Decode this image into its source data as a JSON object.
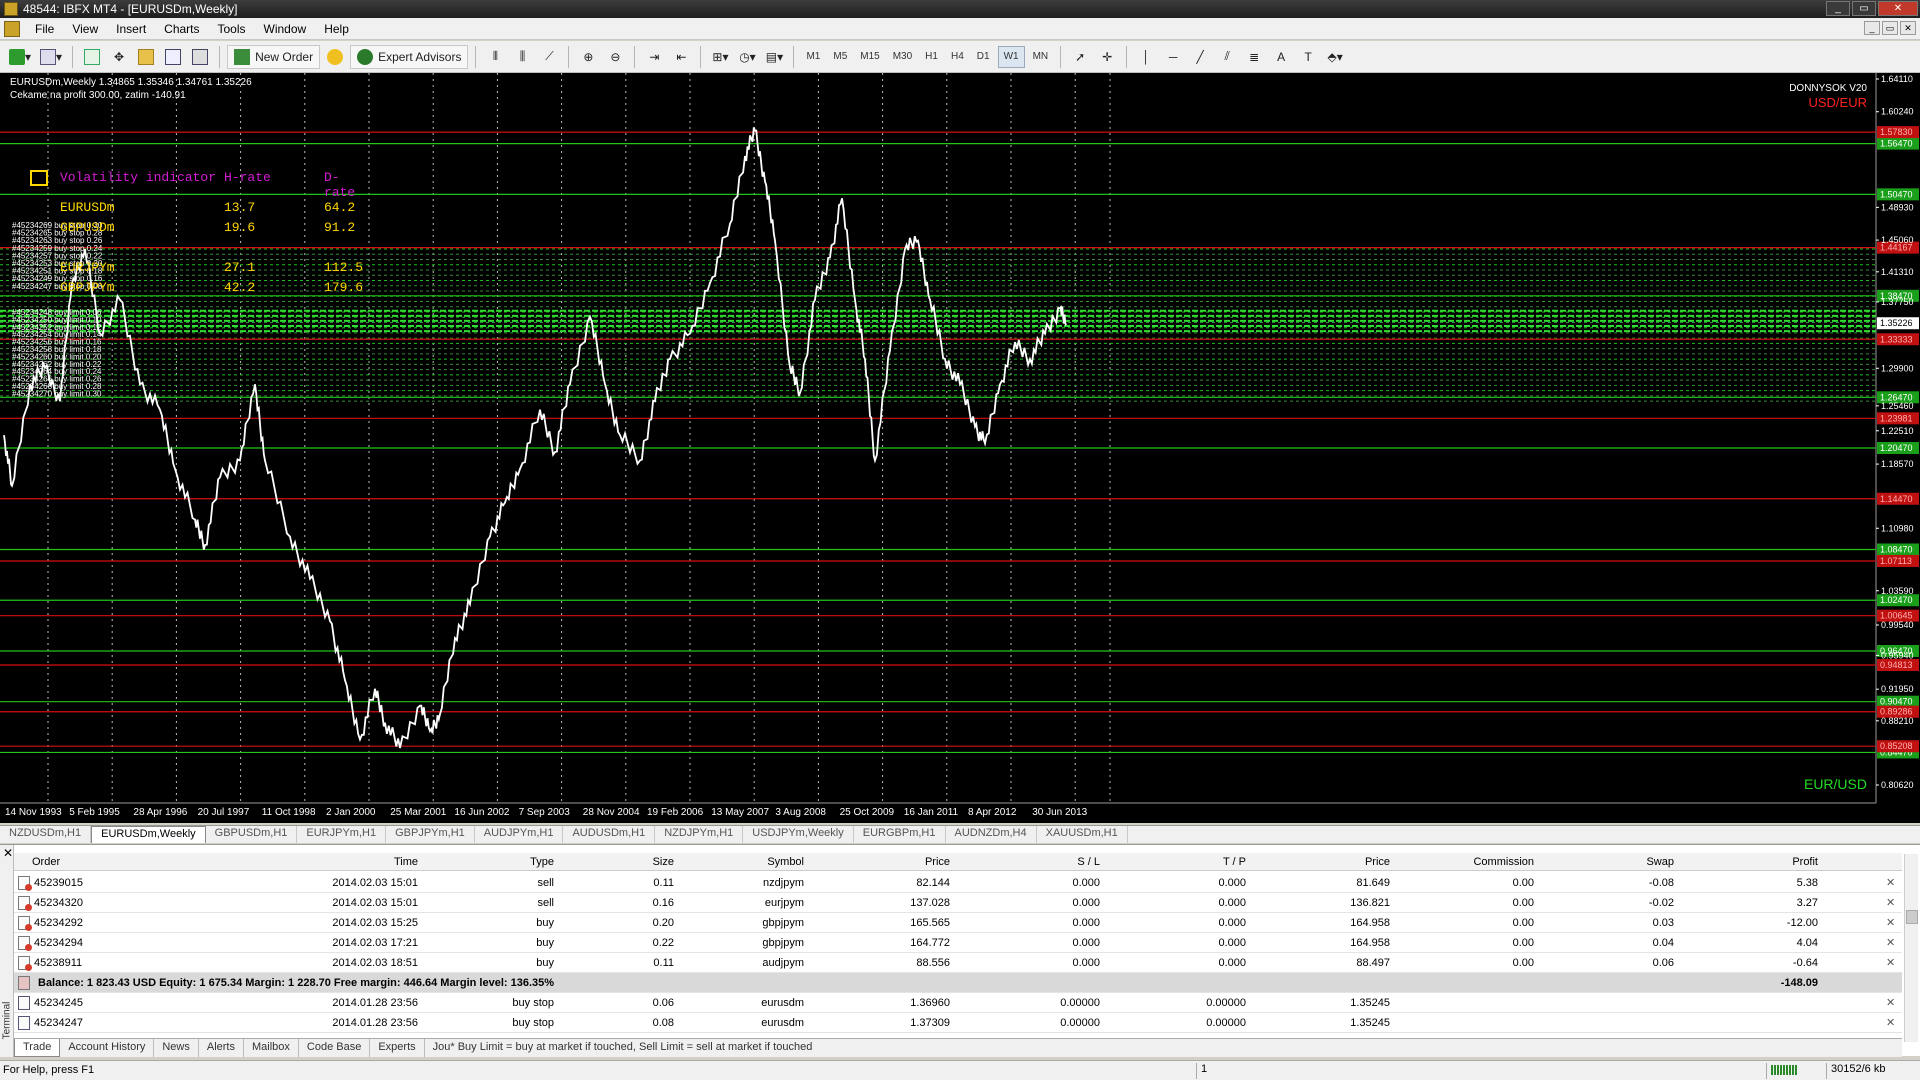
{
  "window": {
    "title": "48544: IBFX MT4 - [EURUSDm,Weekly]"
  },
  "menu": [
    "File",
    "View",
    "Insert",
    "Charts",
    "Tools",
    "Window",
    "Help"
  ],
  "toolbar": {
    "new_order": "New Order",
    "expert_advisors": "Expert Advisors",
    "timeframes": [
      "M1",
      "M5",
      "M15",
      "M30",
      "H1",
      "H4",
      "D1",
      "W1",
      "MN"
    ],
    "active_timeframe": "W1"
  },
  "chart": {
    "header_line1": "EURUSDm,Weekly  1.34865 1.35346 1.34761 1.35226",
    "header_line2": "Cekame na profit 300.00, zatim -140.91",
    "symbol_top": "DONNYSOK V20",
    "symbol_red": "USD/EUR",
    "symbol_green": "EUR/USD",
    "current_price": "1.35226",
    "x_labels": [
      "14 Nov 1993",
      "5 Feb 1995",
      "28 Apr 1996",
      "20 Jul 1997",
      "11 Oct 1998",
      "2 Jan 2000",
      "25 Mar 2001",
      "16 Jun 2002",
      "7 Sep 2003",
      "28 Nov 2004",
      "19 Feb 2006",
      "13 May 2007",
      "3 Aug 2008",
      "25 Oct 2009",
      "16 Jan 2011",
      "8 Apr 2012",
      "30 Jun 2013"
    ],
    "price_labels": [
      "1.64110",
      "1.60240",
      "1.48930",
      "1.45060",
      "1.41310",
      "1.37750",
      "1.29900",
      "1.25460",
      "1.22510",
      "1.18570",
      "1.10980",
      "1.03590",
      "0.99540",
      "0.95940",
      "0.91950",
      "0.88210",
      "0.80620"
    ],
    "green_lines": [
      "1.56470",
      "1.50470",
      "1.38470",
      "1.26470",
      "1.20470",
      "1.08470",
      "1.02470",
      "0.96470",
      "0.90470",
      "0.84470"
    ],
    "red_lines": [
      "1.57830",
      "1.44167",
      "1.33333",
      "1.23981",
      "1.14470",
      "1.07113",
      "1.00645",
      "0.94813",
      "0.89286",
      "0.85208"
    ],
    "order_lines_top": [
      "#45234269 buy stop 0.30",
      "#45234265 buy stop 0.28",
      "#45234263 buy stop 0.26",
      "#45234259 buy stop 0.24",
      "#45234257 buy stop 0.22",
      "#45234253 buy stop 0.20",
      "#45234251 buy stop 0.18",
      "#45234249 buy stop 0.16",
      "#45234247 buy stop 0.08"
    ],
    "order_lines_bottom": [
      "#45234248 buy limit 0.06",
      "#45234250 buy limit 0.10",
      "#45234252 buy limit 0.12",
      "#45234254 buy limit 0.14",
      "#45234256 buy limit 0.16",
      "#45234258 buy limit 0.18",
      "#45234260 buy limit 0.20",
      "#45234262 buy limit 0.22",
      "#45234264 buy limit 0.24",
      "#45234266 buy limit 0.26",
      "#45234268 buy limit 0.28",
      "#45234270 buy limit 0.30"
    ]
  },
  "indicator": {
    "title": "Volatility indicator",
    "col_h": "H-rate",
    "col_d": "D-rate",
    "rows": [
      {
        "symbol": "EURUSDm",
        "h": "13.7",
        "d": "64.2"
      },
      {
        "symbol": "GBPUSDm",
        "h": "19.6",
        "d": "91.2"
      },
      {
        "symbol": "EURJPYm",
        "h": "27.1",
        "d": "112.5"
      },
      {
        "symbol": "GBPJPYm",
        "h": "42.2",
        "d": "179.6"
      }
    ]
  },
  "chart_tabs": [
    "NZDUSDm,H1",
    "EURUSDm,Weekly",
    "GBPUSDm,H1",
    "EURJPYm,H1",
    "GBPJPYm,H1",
    "AUDJPYm,H1",
    "AUDUSDm,H1",
    "NZDJPYm,H1",
    "USDJPYm,Weekly",
    "EURGBPm,H1",
    "AUDNZDm,H4",
    "XAUUSDm,H1"
  ],
  "active_chart_tab": "EURUSDm,Weekly",
  "terminal": {
    "side_label": "Terminal",
    "columns": [
      "Order",
      "Time",
      "Type",
      "Size",
      "Symbol",
      "Price",
      "S / L",
      "T / P",
      "Price",
      "Commission",
      "Swap",
      "Profit"
    ],
    "orders": [
      {
        "order": "45239015",
        "time": "2014.02.03 15:01",
        "type": "sell",
        "size": "0.11",
        "symbol": "nzdjpym",
        "price": "82.144",
        "sl": "0.000",
        "tp": "0.000",
        "cur": "81.649",
        "commission": "0.00",
        "swap": "-0.08",
        "profit": "5.38"
      },
      {
        "order": "45234320",
        "time": "2014.02.03 15:01",
        "type": "sell",
        "size": "0.16",
        "symbol": "eurjpym",
        "price": "137.028",
        "sl": "0.000",
        "tp": "0.000",
        "cur": "136.821",
        "commission": "0.00",
        "swap": "-0.02",
        "profit": "3.27"
      },
      {
        "order": "45234292",
        "time": "2014.02.03 15:25",
        "type": "buy",
        "size": "0.20",
        "symbol": "gbpjpym",
        "price": "165.565",
        "sl": "0.000",
        "tp": "0.000",
        "cur": "164.958",
        "commission": "0.00",
        "swap": "0.03",
        "profit": "-12.00"
      },
      {
        "order": "45234294",
        "time": "2014.02.03 17:21",
        "type": "buy",
        "size": "0.22",
        "symbol": "gbpjpym",
        "price": "164.772",
        "sl": "0.000",
        "tp": "0.000",
        "cur": "164.958",
        "commission": "0.00",
        "swap": "0.04",
        "profit": "4.04"
      },
      {
        "order": "45238911",
        "time": "2014.02.03 18:51",
        "type": "buy",
        "size": "0.11",
        "symbol": "audjpym",
        "price": "88.556",
        "sl": "0.000",
        "tp": "0.000",
        "cur": "88.497",
        "commission": "0.00",
        "swap": "0.06",
        "profit": "-0.64"
      }
    ],
    "summary": "Balance: 1 823.43 USD  Equity: 1 675.34  Margin: 1 228.70  Free margin: 446.64  Margin level: 136.35%",
    "summary_profit": "-148.09",
    "pending": [
      {
        "order": "45234245",
        "time": "2014.01.28 23:56",
        "type": "buy stop",
        "size": "0.06",
        "symbol": "eurusdm",
        "price": "1.36960",
        "sl": "0.00000",
        "tp": "0.00000",
        "cur": "1.35245"
      },
      {
        "order": "45234247",
        "time": "2014.01.28 23:56",
        "type": "buy stop",
        "size": "0.08",
        "symbol": "eurusdm",
        "price": "1.37309",
        "sl": "0.00000",
        "tp": "0.00000",
        "cur": "1.35245"
      }
    ],
    "tabs": [
      "Trade",
      "Account History",
      "News",
      "Alerts",
      "Mailbox",
      "Code Base",
      "Experts",
      "Jou* Buy Limit = buy at market if touched, Sell Limit = sell at market if touched"
    ],
    "active_tab": "Trade"
  },
  "status": {
    "help": "For Help, press F1",
    "section": "1",
    "traffic": "30152/6 kb"
  },
  "colors": {
    "bg": "#000000",
    "grid": "#bdbdbd",
    "price": "#ffffff",
    "green": "#22c41a",
    "red": "#d41010",
    "indicator_text": "#ffd700",
    "indicator_title": "#d41cd4"
  }
}
